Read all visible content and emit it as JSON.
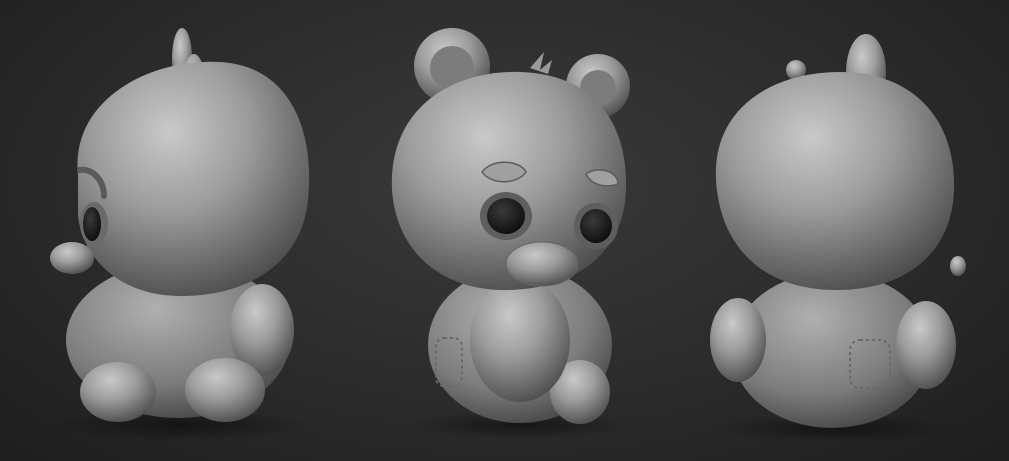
{
  "scene": {
    "background_color": "#2a2a2a",
    "material_color": "#9a9a9a",
    "views": [
      {
        "view": "left-profile"
      },
      {
        "view": "front-three-quarter"
      },
      {
        "view": "back-three-quarter"
      }
    ]
  }
}
